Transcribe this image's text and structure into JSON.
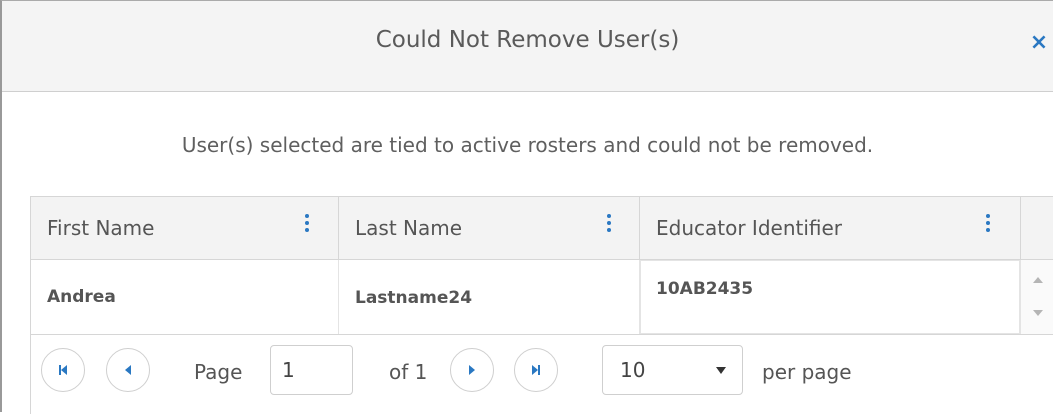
{
  "dialog": {
    "title": "Could Not Remove User(s)",
    "close_label": "×",
    "message": "User(s) selected are tied to active rosters and could not be removed."
  },
  "grid": {
    "columns": [
      {
        "label": "First Name"
      },
      {
        "label": "Last Name"
      },
      {
        "label": "Educator Identifier"
      }
    ],
    "rows": [
      {
        "first_name": "Andrea",
        "last_name": "Lastname24",
        "educator_identifier": "10AB2435"
      }
    ]
  },
  "pager": {
    "page_label": "Page",
    "current_page": "1",
    "of_label": "of 1",
    "page_size": "10",
    "per_page_label": "per page"
  },
  "colors": {
    "accent": "#2a78c2",
    "header_bg": "#f4f4f4",
    "grid_header_bg": "#f3f3f3"
  }
}
